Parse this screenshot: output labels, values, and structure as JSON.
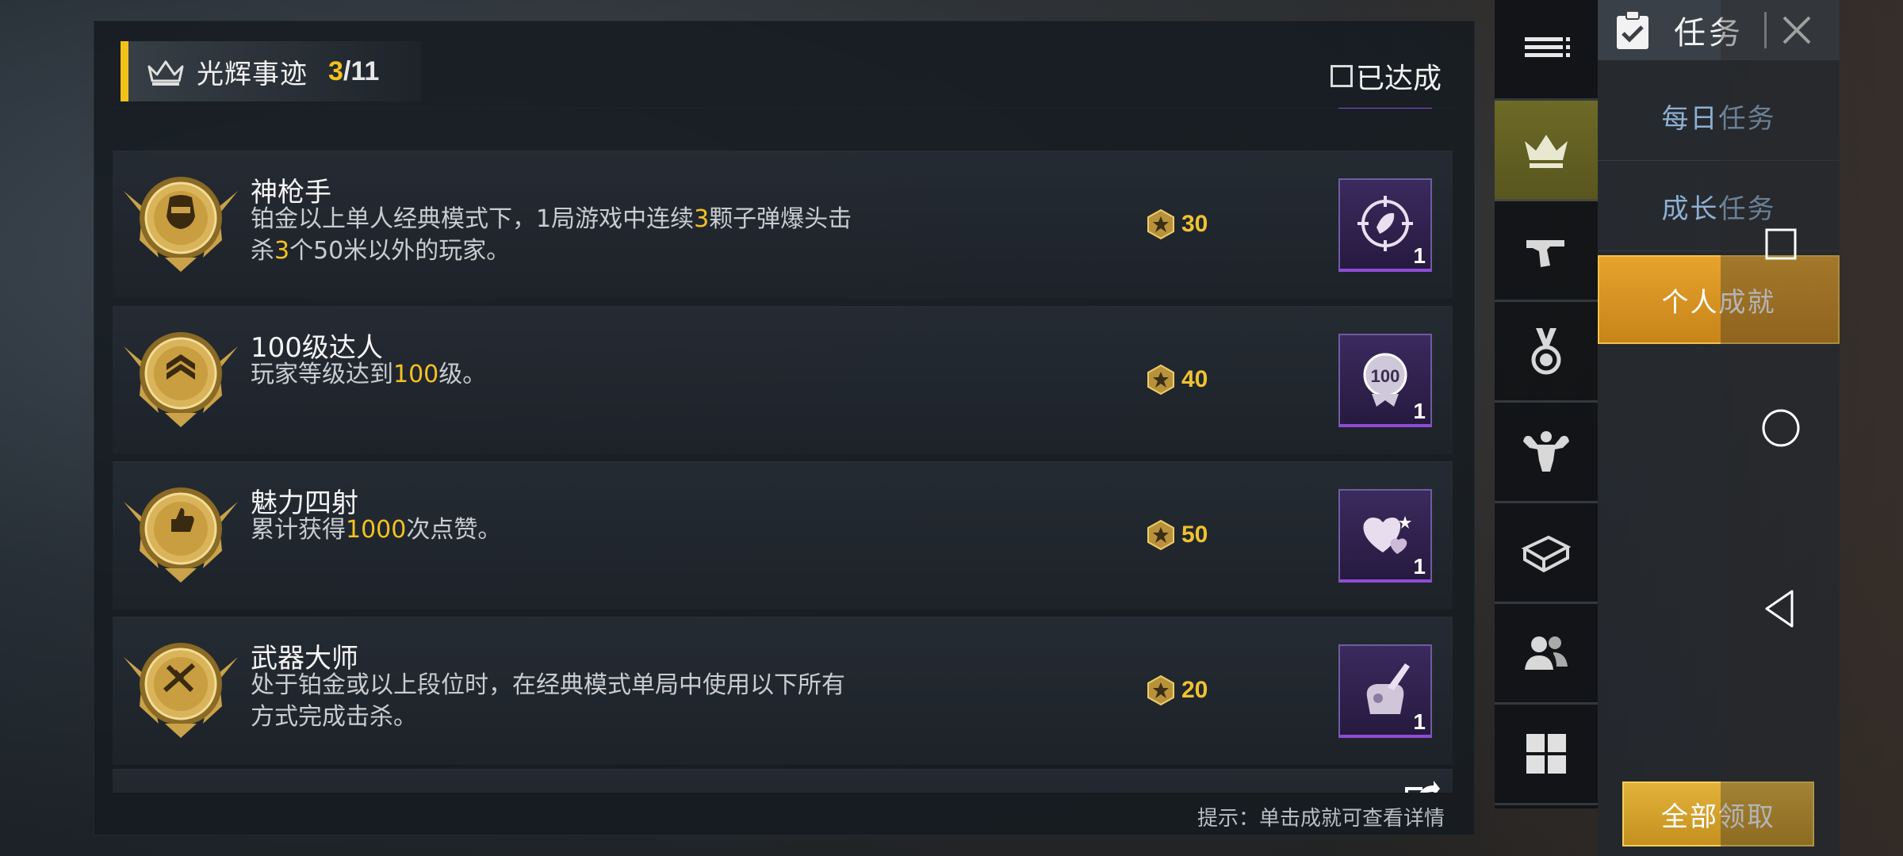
{
  "panel": {
    "header": {
      "title": "光辉事迹",
      "count_current": "3",
      "count_total": "/11"
    },
    "filter": {
      "label": "已达成",
      "checked": false
    },
    "hint": "提示：单击成就可查看详情"
  },
  "achievements": [
    {
      "title": "神枪手",
      "desc_segments": [
        {
          "t": "铂金以上单人经典模式下，1局游戏中连续",
          "hl": false
        },
        {
          "t": "3",
          "hl": true
        },
        {
          "t": "颗子弹爆头击杀",
          "hl": false
        },
        {
          "t": "3",
          "hl": true
        },
        {
          "t": "个50米以外的玩家。",
          "hl": false
        }
      ],
      "points": "30",
      "reward_icon": "crosshair-bullet-icon",
      "reward_qty": "1"
    },
    {
      "title": "100级达人",
      "desc_segments": [
        {
          "t": "玩家等级达到",
          "hl": false
        },
        {
          "t": "100",
          "hl": true
        },
        {
          "t": "级。",
          "hl": false
        }
      ],
      "points": "40",
      "reward_icon": "level-100-badge-icon",
      "reward_qty": "1"
    },
    {
      "title": "魅力四射",
      "desc_segments": [
        {
          "t": "累计获得",
          "hl": false
        },
        {
          "t": "1000",
          "hl": true
        },
        {
          "t": "次点赞。",
          "hl": false
        }
      ],
      "points": "50",
      "reward_icon": "hearts-icon",
      "reward_qty": "1"
    },
    {
      "title": "武器大师",
      "desc_segments": [
        {
          "t": "处于铂金或以上段位时，在经典模式单局中使用以下所有方式完成击杀。",
          "hl": false
        }
      ],
      "points": "20",
      "reward_icon": "weapon-pack-icon",
      "reward_qty": "1"
    }
  ],
  "categories": [
    {
      "name": "menu",
      "icon": "list-icon"
    },
    {
      "name": "glory",
      "icon": "crown-icon",
      "active": true
    },
    {
      "name": "weapons",
      "icon": "pistol-icon"
    },
    {
      "name": "medals",
      "icon": "medal-icon"
    },
    {
      "name": "fitness",
      "icon": "muscle-icon"
    },
    {
      "name": "supplies",
      "icon": "crate-icon"
    },
    {
      "name": "social",
      "icon": "friends-icon"
    },
    {
      "name": "more",
      "icon": "grid-icon"
    }
  ],
  "tasks": {
    "title": "任务",
    "tabs": [
      "每日任务",
      "成长任务",
      "个人成就"
    ],
    "active_tab": 2,
    "claim_all": "全部领取"
  },
  "colors": {
    "accent_gold": "#f4c220",
    "active_tab": "#e6a32c",
    "reward_purple": "#8e4cd6"
  }
}
